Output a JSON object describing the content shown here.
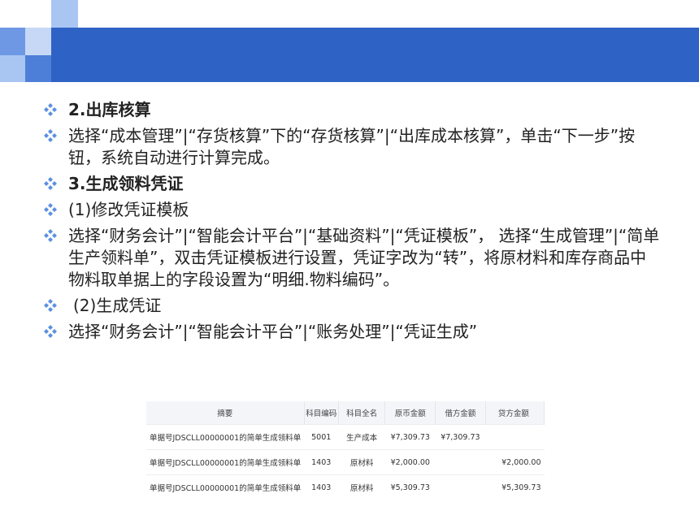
{
  "slide": {
    "bullets": [
      {
        "text": "2.出库核算",
        "bold": true
      },
      {
        "text": "选择“成本管理”|“存货核算”下的“存货核算”|“出库成本核算”，单击“下一步”按钮，系统自动进行计算完成。",
        "bold": false
      },
      {
        "text": "3.生成领料凭证",
        "bold": true
      },
      {
        "text": "(1)修改凭证模板",
        "bold": false
      },
      {
        "text": "选择“财务会计”|“智能会计平台”|“基础资料”|“凭证模板”， 选择“生成管理”|“简单生产领料单”，双击凭证模板进行设置，凭证字改为“转”，将原材料和库存商品中物料取单据上的字段设置为“明细.物料编码”。",
        "bold": false
      },
      {
        "text": "(2)生成凭证",
        "bold": false
      },
      {
        "text": "选择“财务会计”|“智能会计平台”|“账务处理”|“凭证生成”",
        "bold": false
      }
    ],
    "bullet_color": "#5b8fe0"
  },
  "table": {
    "headers": [
      "摘要",
      "科目编码",
      "科目全名",
      "原币金额",
      "借方金额",
      "贷方金额"
    ],
    "rows": [
      [
        "单据号JDSCLL00000001的简单生成领料单",
        "5001",
        "生产成本",
        "¥7,309.73",
        "¥7,309.73",
        ""
      ],
      [
        "单据号JDSCLL00000001的简单生成领料单",
        "1403",
        "原材料",
        "¥2,000.00",
        "",
        "¥2,000.00"
      ],
      [
        "单据号JDSCLL00000001的简单生成领料单",
        "1403",
        "原材料",
        "¥5,309.73",
        "",
        "¥5,309.73"
      ]
    ]
  }
}
